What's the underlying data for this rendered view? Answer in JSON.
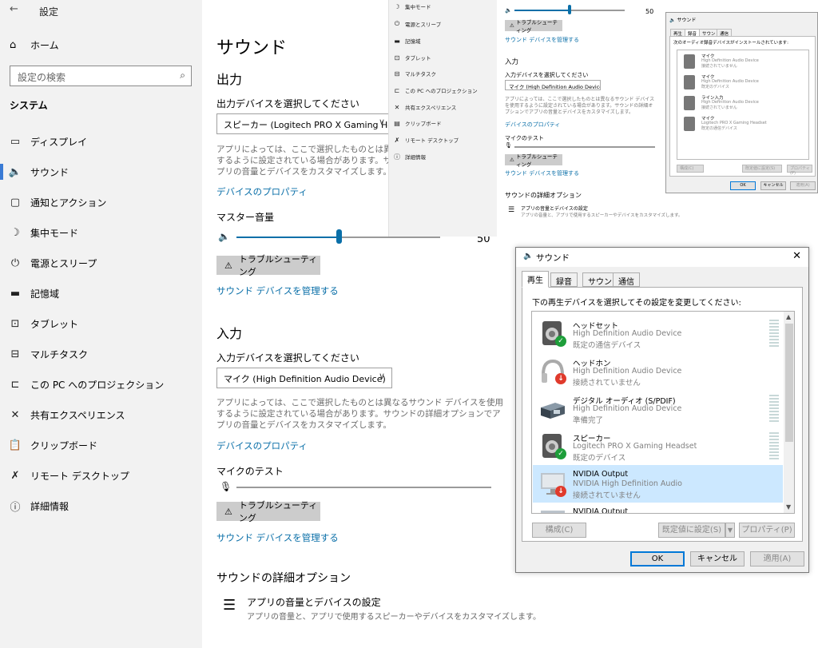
{
  "sidebar": {
    "back_glyph": "←",
    "app_title": "設定",
    "home_label": "ホーム",
    "search_placeholder": "設定の検索",
    "section_title": "システム",
    "items": [
      {
        "icon": "display-icon",
        "glyph": "▭",
        "label": "ディスプレイ"
      },
      {
        "icon": "sound-icon",
        "glyph": "🔈",
        "label": "サウンド"
      },
      {
        "icon": "notification-icon",
        "glyph": "▢",
        "label": "通知とアクション"
      },
      {
        "icon": "moon-icon",
        "glyph": "☽",
        "label": "集中モード"
      },
      {
        "icon": "power-icon",
        "glyph": "⏻",
        "label": "電源とスリープ"
      },
      {
        "icon": "storage-icon",
        "glyph": "▬",
        "label": "記憶域"
      },
      {
        "icon": "tablet-icon",
        "glyph": "⊡",
        "label": "タブレット"
      },
      {
        "icon": "multitask-icon",
        "glyph": "⊟",
        "label": "マルチタスク"
      },
      {
        "icon": "projection-icon",
        "glyph": "⊏",
        "label": "この PC へのプロジェクション"
      },
      {
        "icon": "share-icon",
        "glyph": "✕",
        "label": "共有エクスペリエンス"
      },
      {
        "icon": "clipboard-icon",
        "glyph": "📋",
        "label": "クリップボード"
      },
      {
        "icon": "remote-desktop-icon",
        "glyph": "✗",
        "label": "リモート デスクトップ"
      },
      {
        "icon": "info-icon",
        "glyph": "ⓘ",
        "label": "詳細情報"
      }
    ]
  },
  "main": {
    "title": "サウンド",
    "output_heading": "出力",
    "output_select_label": "出力デバイスを選択してください",
    "output_device": "スピーカー (Logitech PRO X Gaming He...",
    "desc": "アプリによっては、ここで選択したものとは異なるサウンド デバイスを使用するように設定されている場合があります。サウンドの詳細オプションでアプリの音量とデバイスをカスタマイズします。",
    "device_props_link": "デバイスのプロパティ",
    "master_volume_label": "マスター音量",
    "master_volume_value": "50",
    "master_volume_level": 50,
    "troubleshoot_label": "トラブルシューティング",
    "manage_devices_link": "サウンド デバイスを管理する",
    "input_heading": "入力",
    "input_select_label": "入力デバイスを選択してください",
    "input_device": "マイク (High Definition Audio Device)",
    "mic_test_label": "マイクのテスト",
    "advanced_heading": "サウンドの詳細オプション",
    "advanced_item_title": "アプリの音量とデバイスの設定",
    "advanced_item_desc": "アプリの音量と、アプリで使用するスピーカーやデバイスをカスタマイズします。"
  },
  "overlay_sidebar": {
    "items": [
      "集中モード",
      "電源とスリープ",
      "記憶域",
      "タブレット",
      "マルチタスク",
      "この PC へのプロジェクション",
      "共有エクスペリエンス",
      "クリップボード",
      "リモート デスクトップ",
      "詳細情報"
    ]
  },
  "overlay_settings": {
    "volume_value": "50",
    "troubleshoot_label": "トラブルシューティング",
    "manage_link": "サウンド デバイスを管理する",
    "input_heading": "入力",
    "input_select_label": "入力デバイスを選択してください",
    "input_device": "マイク (High Definition Audio Device)",
    "desc": "アプリによっては、ここで選択したものとは異なるサウンド デバイスを使用するように設定されている場合があります。サウンドの詳細オプションでアプリの音量とデバイスをカスタマイズします。",
    "device_props_link": "デバイスのプロパティ",
    "mic_test_label": "マイクのテスト",
    "troubleshoot2_label": "トラブルシューティング",
    "manage2_link": "サウンド デバイスを管理する",
    "advanced_heading": "サウンドの詳細オプション",
    "advanced_item_title": "アプリの音量とデバイスの設定",
    "advanced_item_desc": "アプリの音量と、アプリで使用するスピーカーやデバイスをカスタマイズします。"
  },
  "small_dialog": {
    "title": "サウンド",
    "tabs": [
      "再生",
      "録音",
      "サウンド",
      "通信"
    ],
    "instruction": "次のオーディオ録音デバイスがインストールされています:",
    "devices": [
      {
        "name": "マイク",
        "driver": "High Definition Audio Device",
        "status": "接続されていません"
      },
      {
        "name": "マイク",
        "driver": "High Definition Audio Device",
        "status": "既定のデバイス"
      },
      {
        "name": "ライン入力",
        "driver": "High Definition Audio Device",
        "status": "接続されていません"
      },
      {
        "name": "マイク",
        "driver": "Logitech PRO X Gaming Headset",
        "status": "既定の通信デバイス"
      }
    ],
    "configure_label": "構成(C)",
    "set_default_label": "既定値に設定(S)",
    "properties_label": "プロパティ(P)",
    "ok_label": "OK",
    "cancel_label": "キャンセル",
    "apply_label": "適用(A)"
  },
  "dialog": {
    "title": "サウンド",
    "close_glyph": "✕",
    "tabs": [
      "再生",
      "録音",
      "サウンド",
      "通信"
    ],
    "instruction": "下の再生デバイスを選択してその設定を変更してください:",
    "devices": [
      {
        "name": "ヘッドセット",
        "driver": "High Definition Audio Device",
        "status": "既定の通信デバイス",
        "badge": "✓"
      },
      {
        "name": "ヘッドホン",
        "driver": "High Definition Audio Device",
        "status": "接続されていません",
        "badge": "↓"
      },
      {
        "name": "デジタル オーディオ (S/PDIF)",
        "driver": "High Definition Audio Device",
        "status": "準備完了",
        "badge": ""
      },
      {
        "name": "スピーカー",
        "driver": "Logitech PRO X Gaming Headset",
        "status": "既定のデバイス",
        "badge": "✓"
      },
      {
        "name": "NVIDIA Output",
        "driver": "NVIDIA High Definition Audio",
        "status": "接続されていません",
        "badge": "↓"
      },
      {
        "name": "NVIDIA Output",
        "driver": "",
        "status": "",
        "badge": ""
      }
    ],
    "configure_label": "構成(C)",
    "set_default_label": "既定値に設定(S)",
    "properties_label": "プロパティ(P)",
    "ok_label": "OK",
    "cancel_label": "キャンセル",
    "apply_label": "適用(A)"
  },
  "colors": {
    "accent": "#0a6fa8",
    "selection": "#cce8ff",
    "ok_badge": "#1e9e3a",
    "error_badge": "#e03a2c"
  }
}
